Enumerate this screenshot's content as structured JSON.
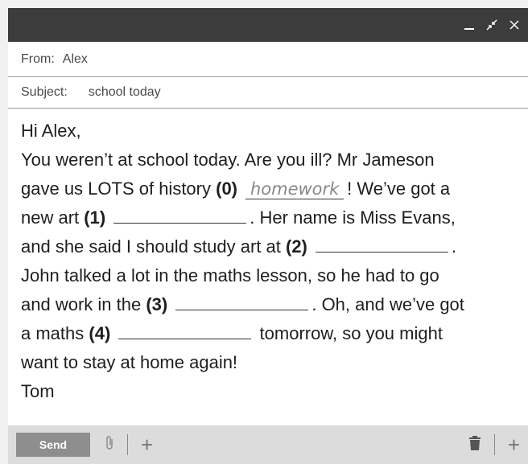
{
  "window": {
    "controls": {
      "minimize": "minimize-icon",
      "shrink": "shrink-icon",
      "close": "close-icon"
    }
  },
  "header": {
    "from_label": "From:",
    "from_value": "Alex",
    "subject_label": "Subject:",
    "subject_value": "school today"
  },
  "message": {
    "greeting": "Hi Alex,",
    "l1": "You weren’t at school today. Are you ill? Mr Jameson",
    "l2a": "gave us LOTS of history",
    "l2n": "(0)",
    "l2ans": "homework",
    "l2b": "! We’ve got a",
    "l3a": "new art",
    "l3n": "(1)",
    "l3b": ". Her name is Miss Evans,",
    "l4a": "and she said I should study art at",
    "l4n": "(2)",
    "l4b": ".",
    "l5": "John talked a lot in the maths lesson, so he had to go",
    "l6a": "and work in the",
    "l6n": "(3)",
    "l6b": ". Oh, and we’ve got",
    "l7a": "a maths",
    "l7n": "(4)",
    "l7b": "tomorrow, so you might",
    "l8": "want to stay at home again!",
    "signoff": "Tom"
  },
  "footer": {
    "send_label": "Send",
    "icons": [
      "paperclip-icon",
      "plus-icon",
      "trash-icon",
      "plus-icon"
    ]
  }
}
